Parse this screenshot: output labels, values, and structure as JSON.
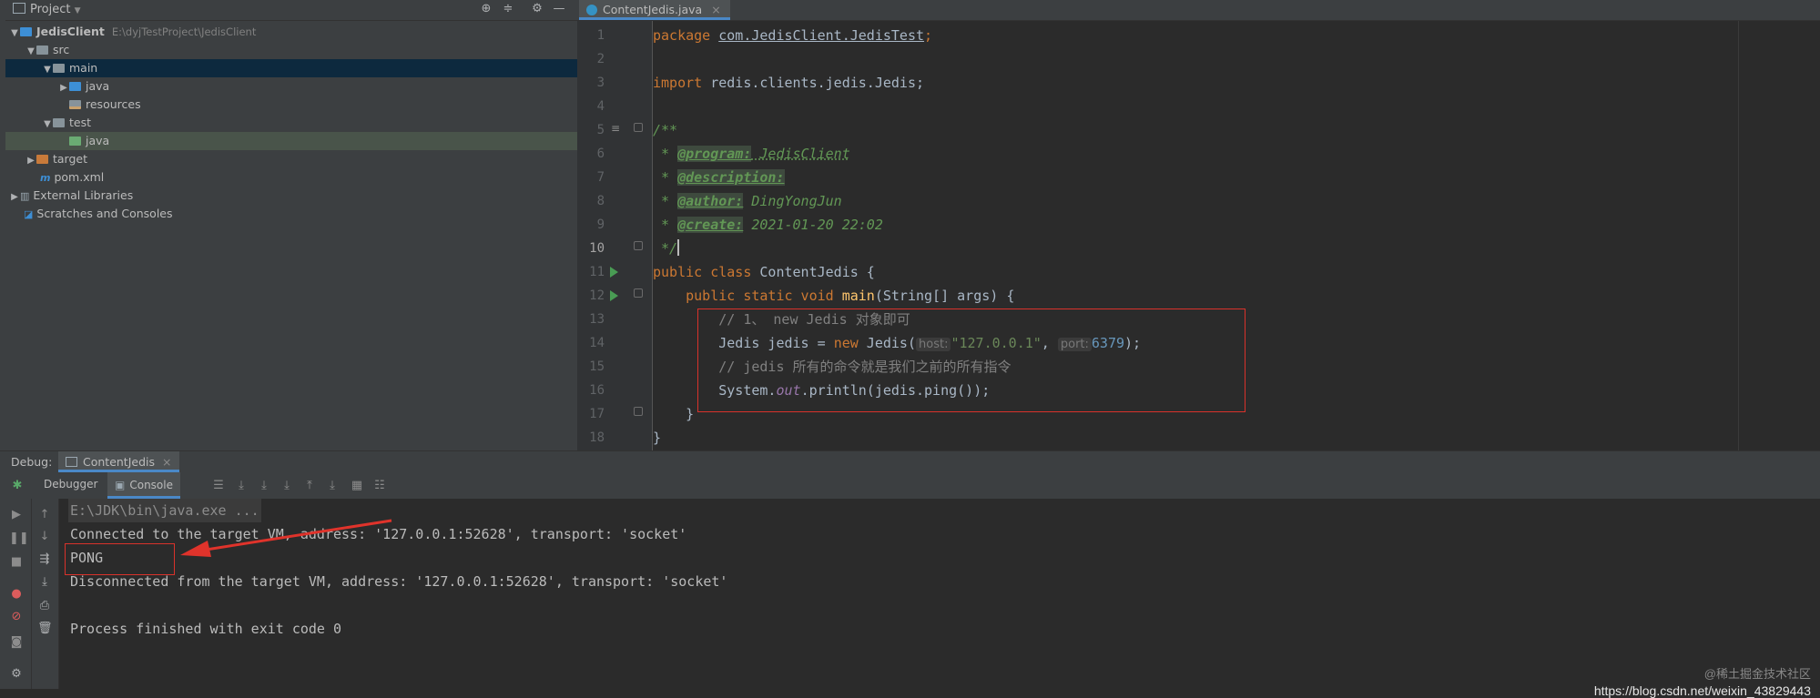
{
  "project_panel": {
    "title": "Project",
    "tree": [
      {
        "label": "JedisClient",
        "path": "E:\\dyjTestProject\\JedisClient"
      },
      {
        "label": "src"
      },
      {
        "label": "main"
      },
      {
        "label": "java"
      },
      {
        "label": "resources"
      },
      {
        "label": "test"
      },
      {
        "label": "java"
      },
      {
        "label": "target"
      },
      {
        "label": "pom.xml"
      },
      {
        "label": "External Libraries"
      },
      {
        "label": "Scratches and Consoles"
      }
    ]
  },
  "editor": {
    "tab_label": "ContentJedis.java",
    "line_numbers": [
      "1",
      "2",
      "3",
      "4",
      "5",
      "6",
      "7",
      "8",
      "9",
      "10",
      "11",
      "12",
      "13",
      "14",
      "15",
      "16",
      "17",
      "18"
    ],
    "code": {
      "l1_kw": "package",
      "l1_rest": "com.JedisClient.JedisTest",
      "l1_semi": ";",
      "l3_kw": "import",
      "l3_rest": " redis.clients.jedis.Jedis;",
      "l5": "/**",
      "l6_star": " * ",
      "l6_tag": "@program:",
      "l6_val": " JedisClient",
      "l7_tag": "@description:",
      "l8_tag": "@author:",
      "l8_val": " DingYongJun",
      "l9_tag": "@create:",
      "l9_val": " 2021-01-20 22:02",
      "l10": " */",
      "l11_kw": "public class",
      "l11_name": " ContentJedis {",
      "l12_kw": "public static void",
      "l12_fn": "main",
      "l12_rest": "(String[] args) {",
      "l13": "// 1、 new Jedis 对象即可",
      "l14_a": "Jedis jedis = ",
      "l14_new": "new",
      "l14_b": " Jedis(",
      "l14_hint1": "host:",
      "l14_str": "\"127.0.0.1\"",
      "l14_c": ", ",
      "l14_hint2": "port:",
      "l14_num": "6379",
      "l14_d": ");",
      "l15": "// jedis 所有的命令就是我们之前的所有指令",
      "l16_a": "System.",
      "l16_out": "out",
      "l16_b": ".println(jedis.ping());",
      "l17": "}",
      "l18": "}"
    }
  },
  "debug": {
    "label": "Debug:",
    "session_tab": "ContentJedis",
    "tab_debugger": "Debugger",
    "tab_console": "Console"
  },
  "console": {
    "lines": [
      "E:\\JDK\\bin\\java.exe ...",
      "Connected to the target VM, address: '127.0.0.1:52628', transport: 'socket'",
      "PONG",
      "Disconnected from the target VM, address: '127.0.0.1:52628', transport: 'socket'",
      "",
      "Process finished with exit code 0"
    ]
  },
  "watermark": {
    "line1": "@稀土掘金技术社区",
    "line2": "https://blog.csdn.net/weixin_43829443"
  },
  "colors": {
    "highlight_box": "#d9322b",
    "selection": "#0d293e",
    "accent": "#4a88c7"
  }
}
